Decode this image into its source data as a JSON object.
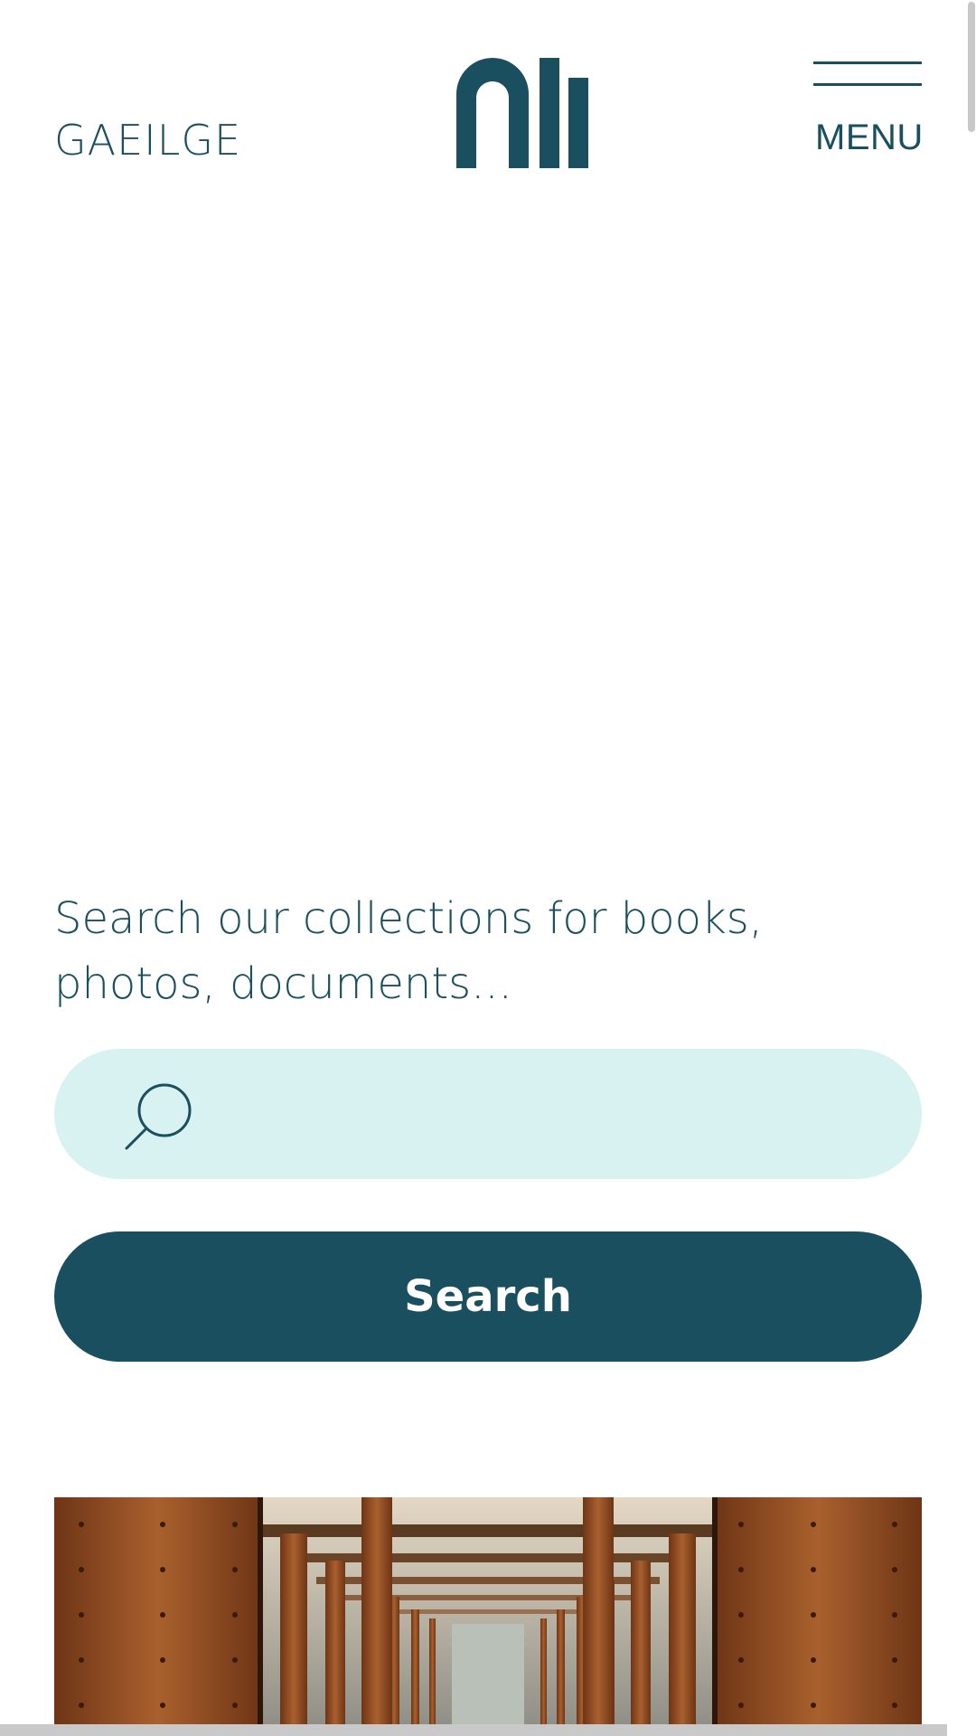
{
  "header": {
    "language_link": "GAEILGE",
    "logo_name": "nli-logo",
    "menu_label": "MENU"
  },
  "search": {
    "prompt": "Search our collections for books, photos, documents...",
    "input_value": "",
    "input_placeholder": "",
    "button_label": "Search"
  },
  "hero": {
    "image": "library-stacks-photo"
  },
  "colors": {
    "brand": "#1a4f5f",
    "search_field_bg": "#d8f1f1",
    "background": "#ffffff"
  }
}
